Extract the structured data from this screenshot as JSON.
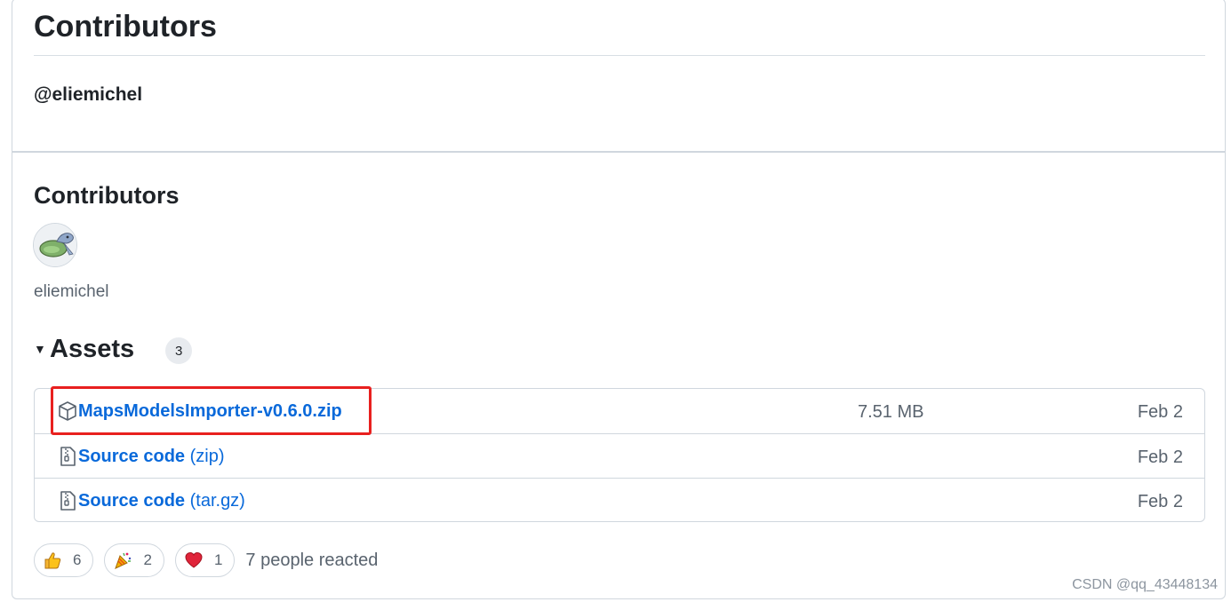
{
  "header": {
    "title": "Contributors",
    "mention": "@eliemichel"
  },
  "contributors": {
    "title": "Contributors",
    "people": [
      {
        "name": "eliemichel",
        "avatar": "avatar-image"
      }
    ]
  },
  "assets": {
    "title": "Assets",
    "count": "3",
    "items": [
      {
        "icon": "package-icon",
        "name": "MapsModelsImporter-v0.6.0.zip",
        "suffix": "",
        "size": "7.51 MB",
        "date": "Feb 2"
      },
      {
        "icon": "file-zip-icon",
        "name": "Source code",
        "suffix": "(zip)",
        "size": "",
        "date": "Feb 2"
      },
      {
        "icon": "file-zip-icon",
        "name": "Source code",
        "suffix": "(tar.gz)",
        "size": "",
        "date": "Feb 2"
      }
    ]
  },
  "reactions": {
    "items": [
      {
        "emoji": "thumbs-up-icon",
        "count": "6"
      },
      {
        "emoji": "party-popper-icon",
        "count": "2"
      },
      {
        "emoji": "heart-icon",
        "count": "1"
      }
    ],
    "summary": "7 people reacted"
  },
  "watermark": "CSDN @qq_43448134",
  "colors": {
    "link": "#0969da",
    "highlight_border": "#e8201f",
    "border": "#d0d7de",
    "muted_text": "#59636e"
  }
}
